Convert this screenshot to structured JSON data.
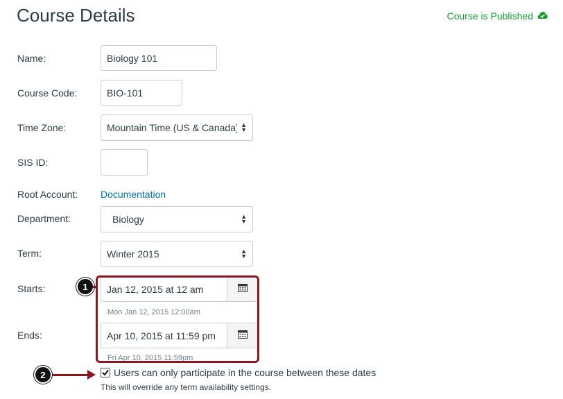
{
  "header": {
    "title": "Course Details",
    "status": "Course is Published",
    "status_icon": "cloud-check-icon",
    "status_color": "#1a9a35"
  },
  "form": {
    "name": {
      "label": "Name:",
      "value": "Biology 101"
    },
    "course_code": {
      "label": "Course Code:",
      "value": "BIO-101"
    },
    "time_zone": {
      "label": "Time Zone:",
      "value": "Mountain Time (US & Canada)"
    },
    "sis_id": {
      "label": "SIS ID:",
      "value": ""
    },
    "root_account": {
      "label": "Root Account:",
      "value": "Documentation"
    },
    "department": {
      "label": "Department:",
      "value": "Biology"
    },
    "term": {
      "label": "Term:",
      "value": "Winter 2015"
    },
    "starts": {
      "label": "Starts:",
      "value": "Jan 12, 2015 at 12 am",
      "hint": "Mon Jan 12, 2015 12:00am",
      "icon": "calendar-icon"
    },
    "ends": {
      "label": "Ends:",
      "value": "Apr 10, 2015 at 11:59 pm",
      "hint": "Fri Apr 10, 2015 11:59pm",
      "icon": "calendar-icon"
    },
    "restrict_dates": {
      "checked": true,
      "label": "Users can only participate in the course between these dates",
      "note": "This will override any term availability settings."
    }
  },
  "annotations": {
    "badge_1": "1",
    "badge_2": "2",
    "highlight_color": "#8a1620"
  }
}
